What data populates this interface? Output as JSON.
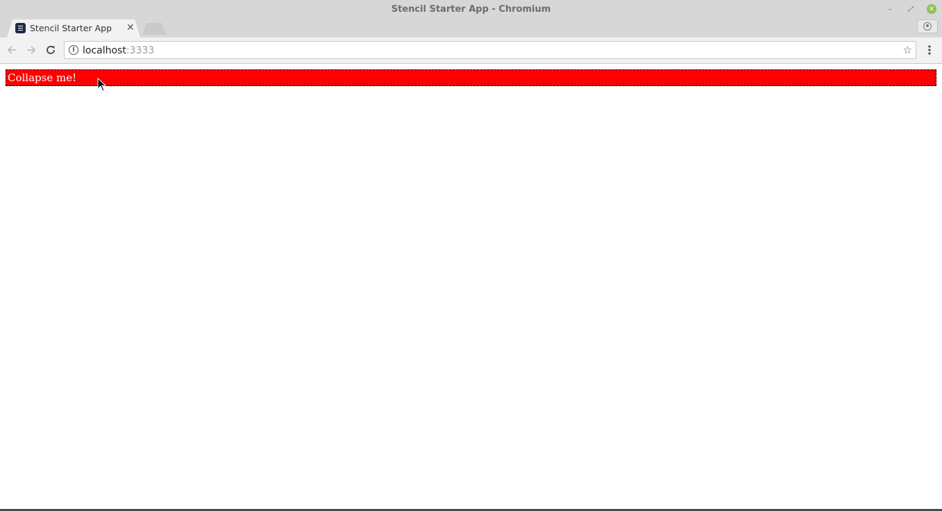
{
  "window": {
    "title": "Stencil Starter App - Chromium",
    "minimize_glyph": "–",
    "restore_glyph": "⤢",
    "close_glyph": "✕"
  },
  "tabs": [
    {
      "title": "Stencil Starter App",
      "close_glyph": "✕",
      "active": true
    }
  ],
  "toolbar": {
    "url_host": "localhost",
    "url_port": ":3333",
    "info_glyph": "i",
    "star_glyph": "☆"
  },
  "page": {
    "collapse_label": "Collapse me!",
    "collapse_bg": "#ff0000",
    "collapse_text_color": "#ffffff"
  }
}
